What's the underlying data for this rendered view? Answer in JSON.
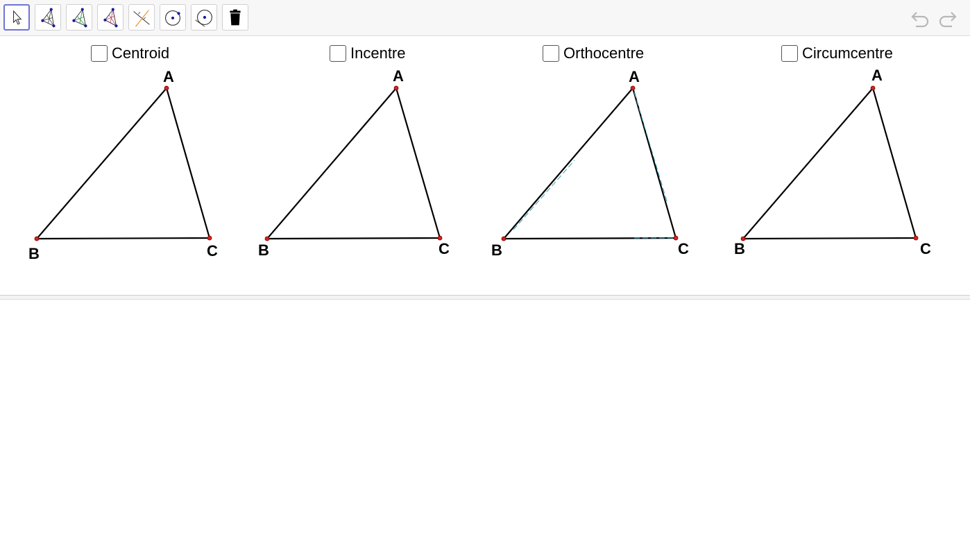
{
  "toolbar": {
    "tools": [
      {
        "name": "move-tool",
        "icon": "arrow-pointer-icon",
        "active": true
      },
      {
        "name": "centroid-tool",
        "icon": "triangle-medians-icon"
      },
      {
        "name": "incentre-tool",
        "icon": "triangle-bisectors-icon"
      },
      {
        "name": "orthocentre-tool",
        "icon": "triangle-altitudes-icon"
      },
      {
        "name": "perpendicular-bisector-tool",
        "icon": "crossing-lines-icon"
      },
      {
        "name": "circle-centre-tool",
        "icon": "circle-with-center-icon"
      },
      {
        "name": "circle-through-point-tool",
        "icon": "circle-through-point-icon"
      },
      {
        "name": "delete-tool",
        "icon": "trash-icon"
      }
    ],
    "undo_icon": "undo-icon",
    "redo_icon": "redo-icon"
  },
  "panels": [
    {
      "checkbox_label": "Centroid",
      "checked": false,
      "vertices": {
        "A": "A",
        "B": "B",
        "C": "C"
      }
    },
    {
      "checkbox_label": "Incentre",
      "checked": false,
      "vertices": {
        "A": "A",
        "B": "B",
        "C": "C"
      }
    },
    {
      "checkbox_label": "Orthocentre",
      "checked": false,
      "vertices": {
        "A": "A",
        "B": "B",
        "C": "C"
      }
    },
    {
      "checkbox_label": "Circumcentre",
      "checked": false,
      "vertices": {
        "A": "A",
        "B": "B",
        "C": "C"
      }
    }
  ],
  "colors": {
    "accent": "#6f73d6",
    "point": "#d62020",
    "segment": "#000000",
    "orthocentre_hint": "#2fa0b0"
  }
}
